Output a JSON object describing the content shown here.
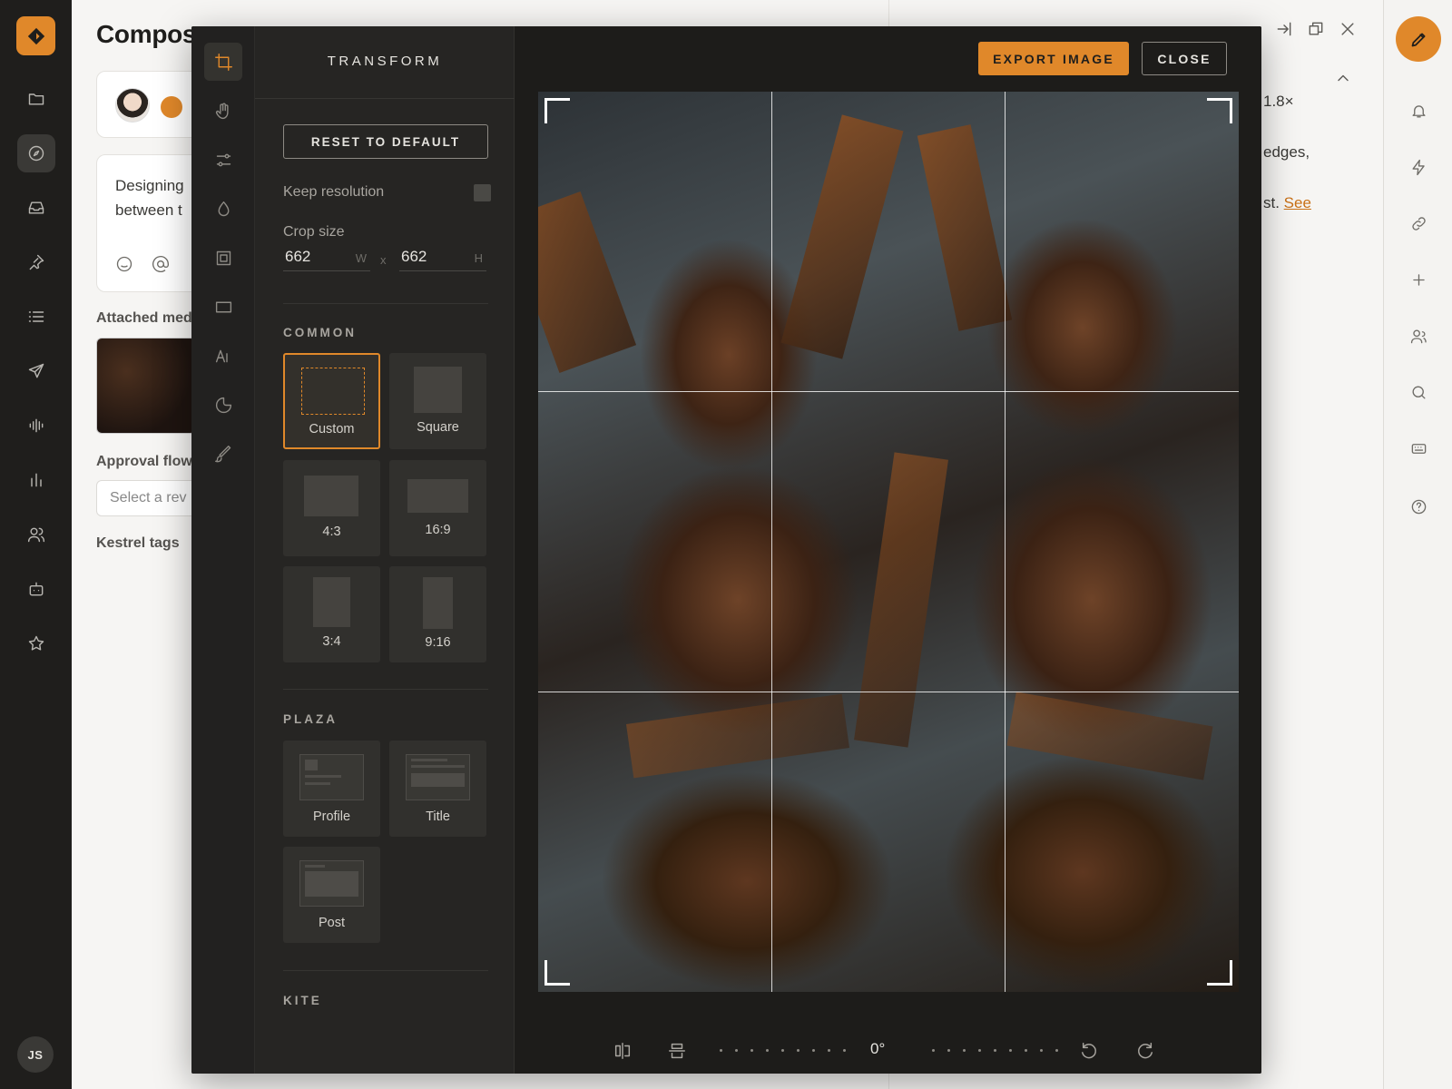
{
  "app": {
    "logo_icon": "diamond-logo-icon",
    "accent_color": "#e0882a"
  },
  "left_nav": {
    "items": [
      {
        "icon": "folder-icon"
      },
      {
        "icon": "compass-icon",
        "active": true
      },
      {
        "icon": "inbox-icon"
      },
      {
        "icon": "pin-icon"
      },
      {
        "icon": "list-icon"
      },
      {
        "icon": "send-icon"
      },
      {
        "icon": "waveform-icon"
      },
      {
        "icon": "bar-chart-icon"
      },
      {
        "icon": "users-icon"
      },
      {
        "icon": "bot-icon"
      },
      {
        "icon": "star-icon"
      }
    ],
    "user_initials": "JS"
  },
  "compose": {
    "title": "Compos",
    "editor_text": "Designing\nbetween t",
    "attached_media_label": "Attached med",
    "approval_flow_label": "Approval flow",
    "approval_select_placeholder": "Select a rev",
    "tags_label": "Kestrel tags"
  },
  "right_panel": {
    "line1": "1.8×",
    "line2": "edges,",
    "line3_prefix": "st. ",
    "link": "See"
  },
  "right_nav": {
    "compose_icon": "pencil-icon",
    "items": [
      "bell-icon",
      "bolt-icon",
      "link-icon",
      "plus-icon",
      "user-plus-icon",
      "search-icon",
      "keyboard-icon",
      "help-icon"
    ]
  },
  "image_editor": {
    "panel_title": "TRANSFORM",
    "reset_label": "RESET TO DEFAULT",
    "keep_resolution_label": "Keep resolution",
    "keep_resolution": false,
    "crop_size_label": "Crop size",
    "crop_width": "662",
    "crop_height": "662",
    "width_unit": "W",
    "height_unit": "H",
    "times": "x",
    "common_heading": "COMMON",
    "common_presets": [
      {
        "label": "Custom",
        "selected": true
      },
      {
        "label": "Square"
      },
      {
        "label": "4:3"
      },
      {
        "label": "16:9"
      },
      {
        "label": "3:4"
      },
      {
        "label": "9:16"
      }
    ],
    "plaza_heading": "PLAZA",
    "plaza_presets": [
      {
        "label": "Profile"
      },
      {
        "label": "Title"
      },
      {
        "label": "Post"
      }
    ],
    "kite_heading": "KITE",
    "export_label": "EXPORT IMAGE",
    "close_label": "CLOSE",
    "rotation": "0°",
    "tools": [
      "crop-icon",
      "hand-icon",
      "sliders-icon",
      "drop-icon",
      "frame-icon",
      "rectangle-icon",
      "text-icon",
      "sticker-icon",
      "brush-icon"
    ]
  }
}
